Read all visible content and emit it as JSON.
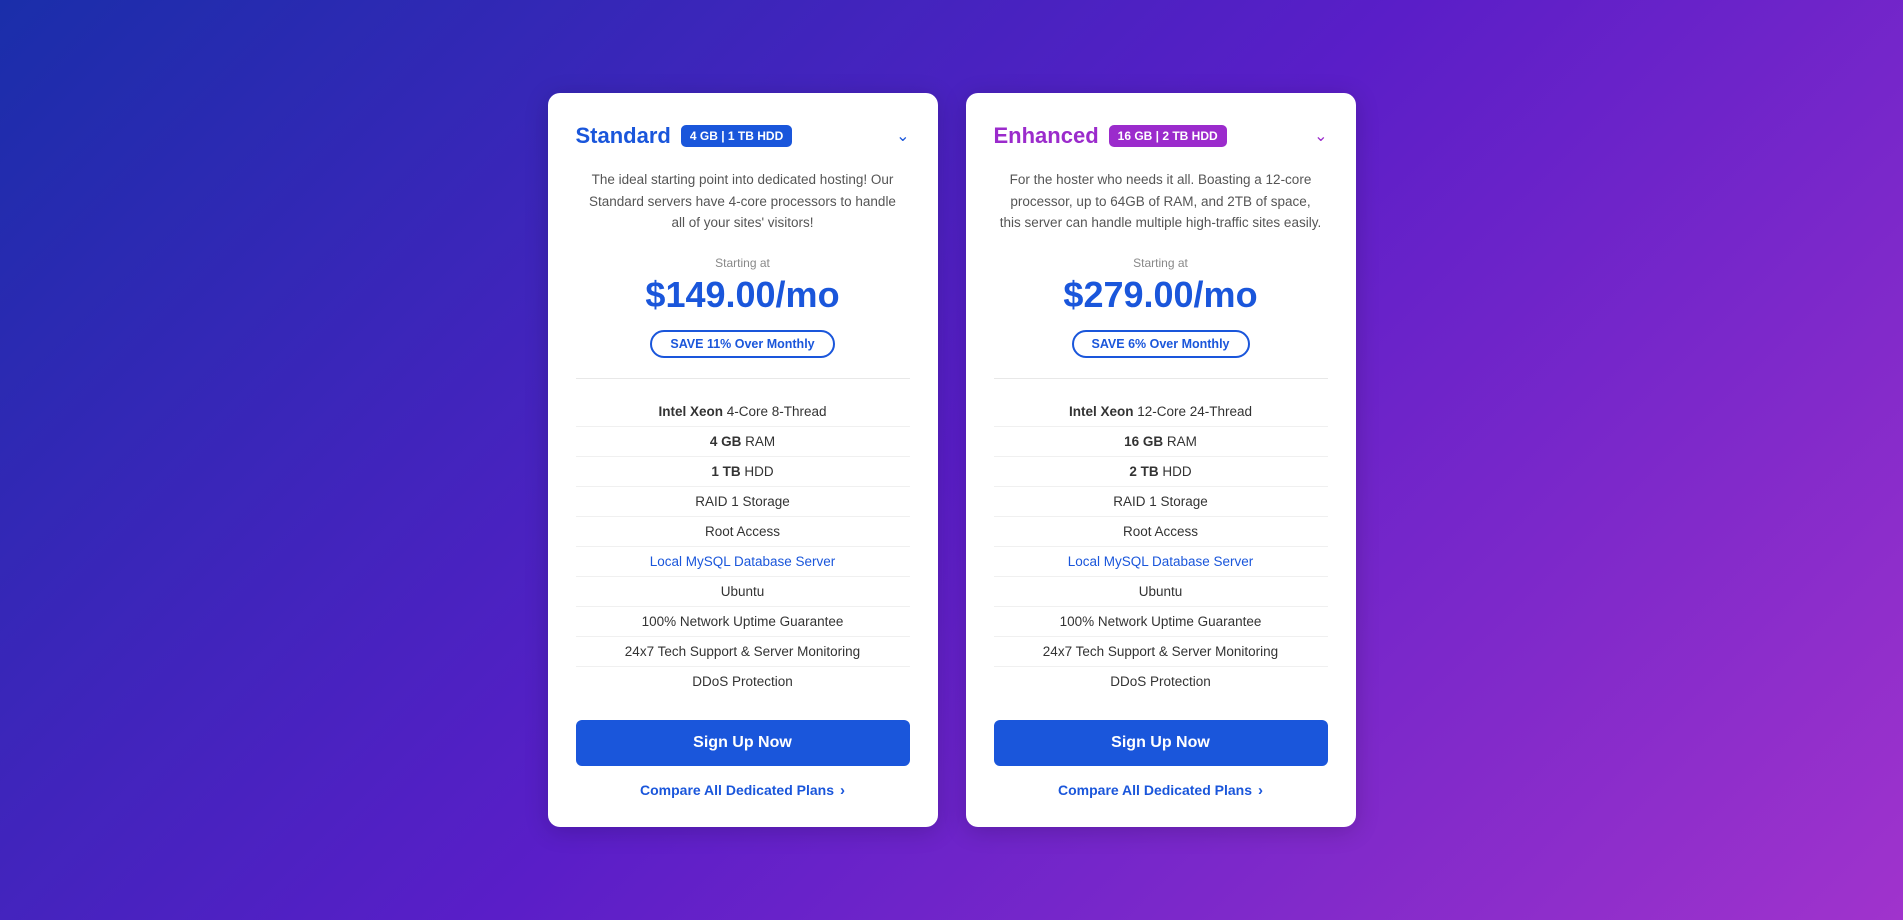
{
  "cards": [
    {
      "id": "standard",
      "title": "Standard",
      "title_color": "blue",
      "badge": "4 GB | 1 TB HDD",
      "badge_color": "blue",
      "description": "The ideal starting point into dedicated hosting! Our Standard servers have 4-core processors to handle all of your sites' visitors!",
      "starting_at_label": "Starting at",
      "price": "$149.00/mo",
      "save_badge": "SAVE 11% Over Monthly",
      "features": [
        {
          "text_bold": "Intel Xeon",
          "text_regular": " 4-Core 8-Thread",
          "highlight": false
        },
        {
          "text_bold": "4 GB",
          "text_regular": " RAM",
          "highlight": false
        },
        {
          "text_bold": "1 TB",
          "text_regular": " HDD",
          "highlight": false
        },
        {
          "text_bold": "",
          "text_regular": "RAID 1 Storage",
          "highlight": false
        },
        {
          "text_bold": "",
          "text_regular": "Root Access",
          "highlight": false
        },
        {
          "text_bold": "",
          "text_regular": "Local MySQL Database Server",
          "highlight": true
        },
        {
          "text_bold": "",
          "text_regular": "Ubuntu",
          "highlight": false
        },
        {
          "text_bold": "",
          "text_regular": "100% Network Uptime Guarantee",
          "highlight": false
        },
        {
          "text_bold": "",
          "text_regular": "24x7 Tech Support & Server Monitoring",
          "highlight": false
        },
        {
          "text_bold": "",
          "text_regular": "DDoS Protection",
          "highlight": false
        }
      ],
      "signup_label": "Sign Up Now",
      "compare_label": "Compare All Dedicated Plans"
    },
    {
      "id": "enhanced",
      "title": "Enhanced",
      "title_color": "purple",
      "badge": "16 GB | 2 TB HDD",
      "badge_color": "purple",
      "description": "For the hoster who needs it all. Boasting a 12-core processor, up to 64GB of RAM, and 2TB of space, this server can handle multiple high-traffic sites easily.",
      "starting_at_label": "Starting at",
      "price": "$279.00/mo",
      "save_badge": "SAVE 6% Over Monthly",
      "features": [
        {
          "text_bold": "Intel Xeon",
          "text_regular": " 12-Core 24-Thread",
          "highlight": false
        },
        {
          "text_bold": "16 GB",
          "text_regular": " RAM",
          "highlight": false
        },
        {
          "text_bold": "2 TB",
          "text_regular": " HDD",
          "highlight": false
        },
        {
          "text_bold": "",
          "text_regular": "RAID 1 Storage",
          "highlight": false
        },
        {
          "text_bold": "",
          "text_regular": "Root Access",
          "highlight": false
        },
        {
          "text_bold": "",
          "text_regular": "Local MySQL Database Server",
          "highlight": true
        },
        {
          "text_bold": "",
          "text_regular": "Ubuntu",
          "highlight": false
        },
        {
          "text_bold": "",
          "text_regular": "100% Network Uptime Guarantee",
          "highlight": false
        },
        {
          "text_bold": "",
          "text_regular": "24x7 Tech Support & Server Monitoring",
          "highlight": false
        },
        {
          "text_bold": "",
          "text_regular": "DDoS Protection",
          "highlight": false
        }
      ],
      "signup_label": "Sign Up Now",
      "compare_label": "Compare All Dedicated Plans"
    }
  ]
}
